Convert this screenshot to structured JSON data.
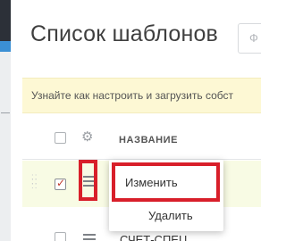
{
  "page": {
    "title": "Список шаблонов",
    "search_placeholder": "Ф"
  },
  "banner": {
    "text": "Узнайте как настроить и загрузить собст"
  },
  "table": {
    "column_name": "НАЗВАНИЕ",
    "rows": [
      {
        "checked": true,
        "name": ""
      },
      {
        "checked": false,
        "name": "СЧЕТ-СПЕЦ"
      }
    ]
  },
  "context_menu": {
    "edit_label": "Изменить",
    "delete_label": "Удалить"
  },
  "colors": {
    "highlight_box": "#d81f2a",
    "banner_bg": "#fdf8d4",
    "selected_row_bg": "#f8fbe4",
    "nav_dark": "#2c3038",
    "nav_accent": "#3b8fd4"
  },
  "icons": [
    "gear-icon",
    "hamburger-menu-icon",
    "drag-handle-icon",
    "checkmark-icon"
  ]
}
